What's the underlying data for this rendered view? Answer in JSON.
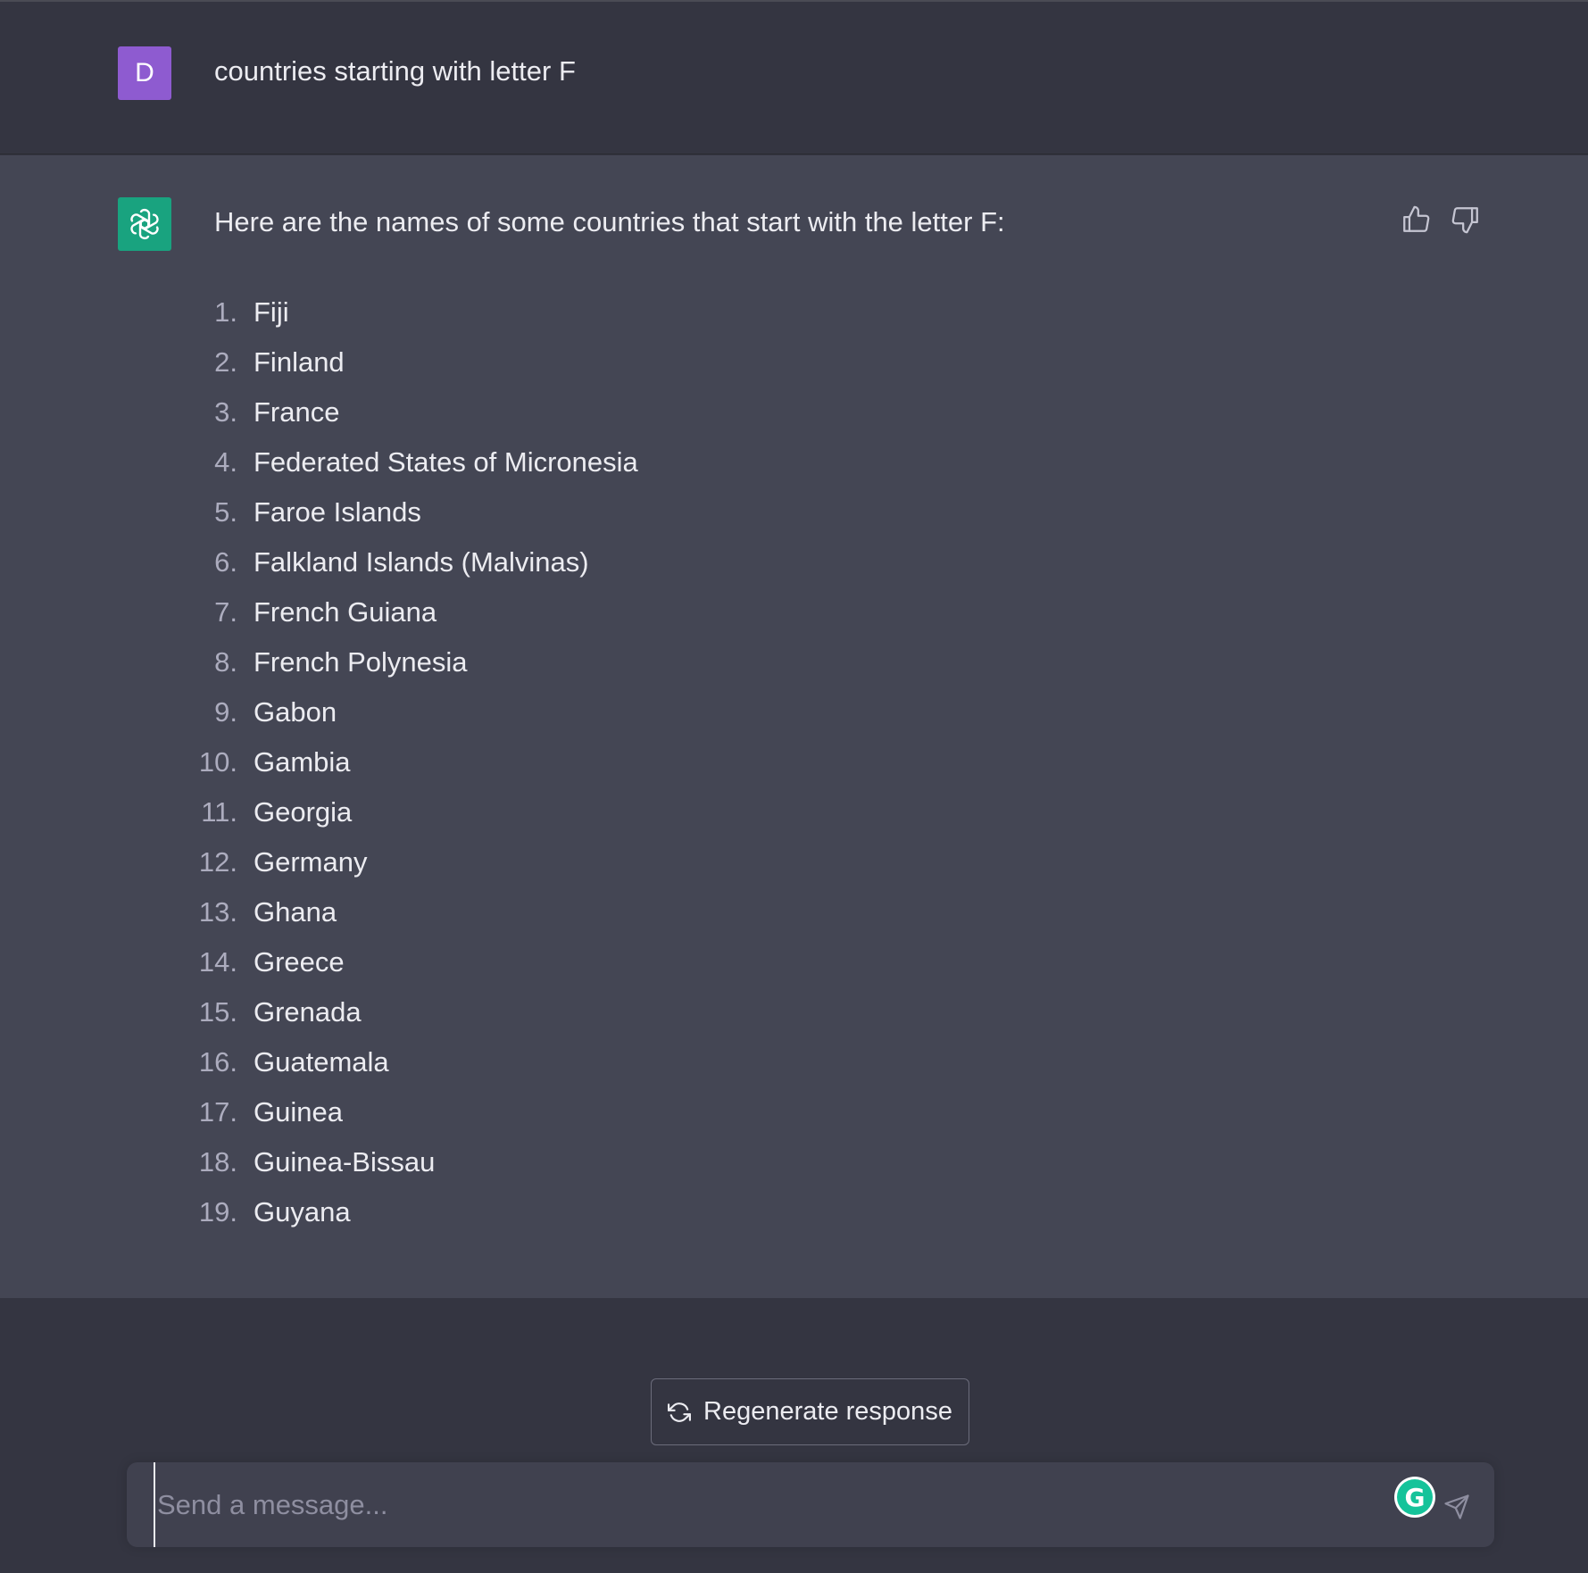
{
  "user_message": {
    "avatar_letter": "D",
    "text": "countries starting with letter F"
  },
  "assistant_message": {
    "intro": "Here are the names of some countries that start with the letter F:",
    "items": [
      {
        "num": "1.",
        "name": "Fiji"
      },
      {
        "num": "2.",
        "name": "Finland"
      },
      {
        "num": "3.",
        "name": "France"
      },
      {
        "num": "4.",
        "name": "Federated States of Micronesia"
      },
      {
        "num": "5.",
        "name": "Faroe Islands"
      },
      {
        "num": "6.",
        "name": "Falkland Islands (Malvinas)"
      },
      {
        "num": "7.",
        "name": "French Guiana"
      },
      {
        "num": "8.",
        "name": "French Polynesia"
      },
      {
        "num": "9.",
        "name": "Gabon"
      },
      {
        "num": "10.",
        "name": "Gambia"
      },
      {
        "num": "11.",
        "name": "Georgia"
      },
      {
        "num": "12.",
        "name": "Germany"
      },
      {
        "num": "13.",
        "name": "Ghana"
      },
      {
        "num": "14.",
        "name": "Greece"
      },
      {
        "num": "15.",
        "name": "Grenada"
      },
      {
        "num": "16.",
        "name": "Guatemala"
      },
      {
        "num": "17.",
        "name": "Guinea"
      },
      {
        "num": "18.",
        "name": "Guinea-Bissau"
      },
      {
        "num": "19.",
        "name": "Guyana"
      }
    ]
  },
  "regenerate": {
    "label": "Regenerate response"
  },
  "composer": {
    "placeholder": "Send a message..."
  },
  "icons": {
    "user_avatar": "user-avatar",
    "bot_avatar": "openai-logo-icon",
    "thumbs_up": "thumbs-up-icon",
    "thumbs_down": "thumbs-down-icon",
    "regenerate": "refresh-icon",
    "grammarly": "grammarly-icon",
    "send": "send-icon"
  },
  "colors": {
    "user_avatar_bg": "#8e5bd0",
    "bot_avatar_bg": "#19a37f",
    "page_bg": "#343541",
    "assistant_bg": "#444654"
  }
}
